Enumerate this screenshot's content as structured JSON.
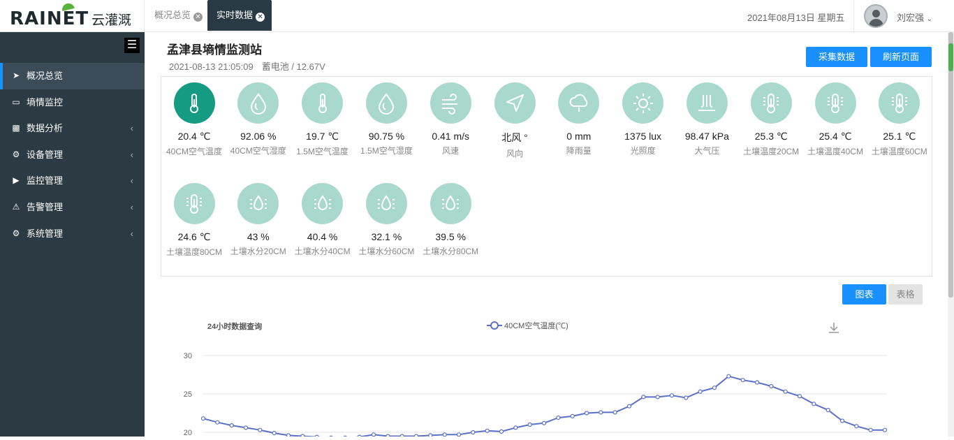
{
  "logo": {
    "brand": "RAINET",
    "brand_cn": "云灌溉"
  },
  "tabs": [
    {
      "label": "概况总览"
    },
    {
      "label": "实时数据"
    }
  ],
  "header": {
    "date": "2021年08月13日 星期五",
    "username": "刘宏强"
  },
  "sidebar": {
    "items": [
      {
        "label": "概况总览",
        "icon": "send-icon"
      },
      {
        "label": "墒情监控",
        "icon": "monitor-icon"
      },
      {
        "label": "数据分析",
        "icon": "bar-chart-icon"
      },
      {
        "label": "设备管理",
        "icon": "gear-icon"
      },
      {
        "label": "监控管理",
        "icon": "video-icon"
      },
      {
        "label": "告警管理",
        "icon": "warning-icon"
      },
      {
        "label": "系统管理",
        "icon": "gears-icon"
      }
    ]
  },
  "station": {
    "title": "孟津县墒情监测站",
    "timestamp": "2021-08-13 21:05:09",
    "battery": "蓄电池 / 12.67V",
    "collect_label": "采集数据",
    "refresh_label": "刷新页面"
  },
  "sensors": [
    {
      "value": "20.4 ℃",
      "label": "40CM空气温度",
      "icon": "thermometer-icon"
    },
    {
      "value": "92.06 %",
      "label": "40CM空气湿度",
      "icon": "water-drop-icon"
    },
    {
      "value": "19.7 ℃",
      "label": "1.5M空气温度",
      "icon": "thermometer-icon"
    },
    {
      "value": "90.75 %",
      "label": "1.5M空气湿度",
      "icon": "water-drop-icon"
    },
    {
      "value": "0.41 m/s",
      "label": "风速",
      "icon": "wind-icon"
    },
    {
      "value": "北风 °",
      "label": "风向",
      "icon": "navigation-icon"
    },
    {
      "value": "0 mm",
      "label": "降雨量",
      "icon": "rain-cloud-icon"
    },
    {
      "value": "1375 lux",
      "label": "光照度",
      "icon": "sun-icon"
    },
    {
      "value": "98.47 kPa",
      "label": "大气压",
      "icon": "pressure-icon"
    },
    {
      "value": "25.3 ℃",
      "label": "土壤温度20CM",
      "icon": "soil-thermometer-icon"
    },
    {
      "value": "25.4 ℃",
      "label": "土壤温度40CM",
      "icon": "soil-thermometer-icon"
    },
    {
      "value": "25.1 ℃",
      "label": "土壤温度60CM",
      "icon": "soil-thermometer-icon"
    },
    {
      "value": "24.6 ℃",
      "label": "土壤温度80CM",
      "icon": "soil-thermometer-icon"
    },
    {
      "value": "43 %",
      "label": "土壤水分20CM",
      "icon": "soil-moisture-icon"
    },
    {
      "value": "40.4 %",
      "label": "土壤水分40CM",
      "icon": "soil-moisture-icon"
    },
    {
      "value": "32.1 %",
      "label": "土壤水分60CM",
      "icon": "soil-moisture-icon"
    },
    {
      "value": "39.5 %",
      "label": "土壤水分80CM",
      "icon": "soil-moisture-icon"
    }
  ],
  "view_toggle": {
    "chart_label": "图表",
    "table_label": "表格"
  },
  "colors": {
    "accent": "#1890ff",
    "sidebar": "#2b3a43",
    "icon_primary": "#169b83",
    "icon_light": "#a9d9cd",
    "series": "#5b70c9"
  },
  "chart_data": {
    "type": "line",
    "title": "24小时数据查询",
    "series": [
      {
        "name": "40CM空气温度(℃)",
        "values": [
          21.8,
          21.3,
          20.9,
          20.6,
          20.3,
          19.9,
          19.6,
          19.5,
          19.4,
          19.3,
          19.3,
          19.4,
          19.7,
          19.5,
          19.5,
          19.5,
          19.6,
          19.7,
          19.7,
          20.0,
          20.2,
          20.1,
          20.6,
          21.0,
          21.2,
          21.9,
          22.1,
          22.5,
          22.6,
          22.6,
          23.4,
          24.6,
          24.6,
          24.8,
          24.5,
          25.3,
          25.8,
          27.3,
          26.8,
          26.5,
          26.0,
          25.3,
          24.7,
          23.7,
          22.9,
          21.5,
          20.8,
          20.3,
          20.3
        ]
      }
    ],
    "ylim": [
      20,
      30
    ],
    "yticks": [
      "30",
      "25",
      "20"
    ]
  }
}
